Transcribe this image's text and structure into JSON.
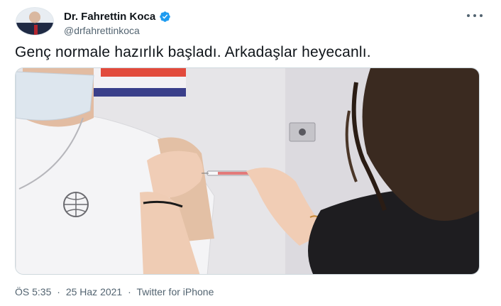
{
  "tweet": {
    "author_name": "Dr. Fahrettin Koca",
    "author_handle": "@drfahrettinkoca",
    "text": "Genç normale hazırlık başladı. Arkadaşlar heyecanlı.",
    "time": "ÖS 5:35",
    "separator": "·",
    "date": "25 Haz 2021",
    "source": "Twitter for iPhone",
    "verified": true,
    "media_description_icon": "vaccination-photo"
  },
  "colors": {
    "verified_blue": "#1d9bf0",
    "text_primary": "#0f1419",
    "text_secondary": "#536471",
    "border": "#cfd9de"
  }
}
